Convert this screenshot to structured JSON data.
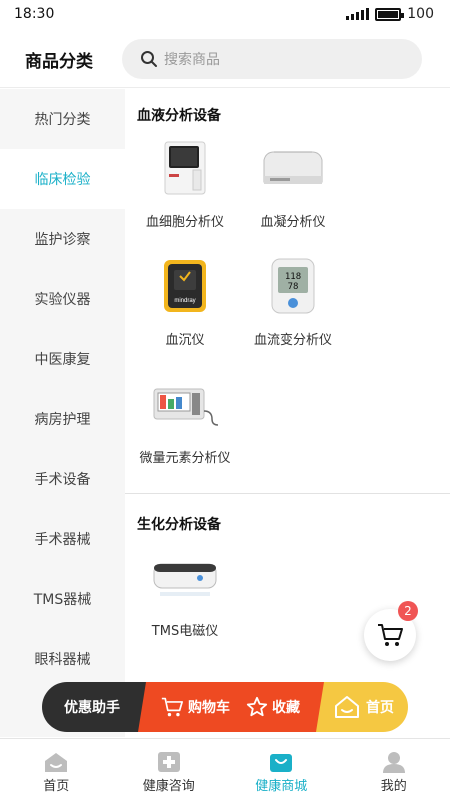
{
  "status": {
    "time": "18:30",
    "battery": "100"
  },
  "header": {
    "title": "商品分类",
    "search_placeholder": "搜索商品"
  },
  "sidebar": {
    "items": [
      {
        "label": "热门分类",
        "active": false
      },
      {
        "label": "临床检验",
        "active": true
      },
      {
        "label": "监护诊察",
        "active": false
      },
      {
        "label": "实验仪器",
        "active": false
      },
      {
        "label": "中医康复",
        "active": false
      },
      {
        "label": "病房护理",
        "active": false
      },
      {
        "label": "手术设备",
        "active": false
      },
      {
        "label": "手术器械",
        "active": false
      },
      {
        "label": "TMS器械",
        "active": false
      },
      {
        "label": "眼科器械",
        "active": false
      }
    ]
  },
  "content": {
    "sections": [
      {
        "title": "血液分析设备",
        "products": [
          {
            "name": "血细胞分析仪",
            "icon": "blood-cell-analyzer-image"
          },
          {
            "name": "血凝分析仪",
            "icon": "coagulation-analyzer-image"
          },
          {
            "name": "血沉仪",
            "icon": "esr-analyzer-image",
            "brand": "mindray"
          },
          {
            "name": "血流变分析仪",
            "icon": "hemorheology-analyzer-image",
            "readings": [
              "118",
              "78"
            ]
          },
          {
            "name": "微量元素分析仪",
            "icon": "trace-element-analyzer-image"
          }
        ]
      },
      {
        "title": "生化分析设备",
        "products": [
          {
            "name": "TMS电磁仪",
            "icon": "tms-device-image"
          }
        ]
      }
    ]
  },
  "cart": {
    "badge": "2"
  },
  "actions": {
    "helper": "优惠助手",
    "cart": "购物车",
    "favorite": "收藏",
    "home": "首页"
  },
  "tabbar": {
    "items": [
      {
        "label": "首页",
        "icon": "home-icon",
        "active": false
      },
      {
        "label": "健康咨询",
        "icon": "medical-cross-icon",
        "active": false
      },
      {
        "label": "健康商城",
        "icon": "shopping-bag-icon",
        "active": true
      },
      {
        "label": "我的",
        "icon": "user-icon",
        "active": false
      }
    ]
  },
  "colors": {
    "accent": "#1ab0c8",
    "badge": "#f05555",
    "cart_red": "#ee4a22",
    "home_yellow": "#f5c842",
    "helper_dark": "#2f2f2f"
  }
}
